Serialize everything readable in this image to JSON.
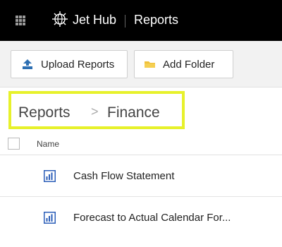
{
  "header": {
    "app_name": "Jet Hub",
    "section": "Reports",
    "icons": {
      "menu": "app-grid-icon",
      "logo": "jet-hub-globe-icon"
    }
  },
  "toolbar": {
    "upload_label": "Upload Reports",
    "add_folder_label": "Add Folder",
    "icons": {
      "upload": "upload-icon",
      "folder": "folder-icon"
    }
  },
  "breadcrumb": {
    "items": [
      "Reports",
      "Finance"
    ],
    "separator": ">",
    "highlight_color": "#e7f12b"
  },
  "table": {
    "columns": [
      "Name"
    ],
    "rows": [
      {
        "name": "Cash Flow Statement",
        "icon": "report-icon"
      },
      {
        "name": "Forecast to Actual Calendar For...",
        "icon": "report-icon"
      }
    ]
  },
  "colors": {
    "topbar": "#000000",
    "toolbar": "#f2f2f2",
    "report_icon": "#2b5eb8",
    "upload_icon": "#2d6fb2",
    "folder_icon": "#f0c13a"
  }
}
